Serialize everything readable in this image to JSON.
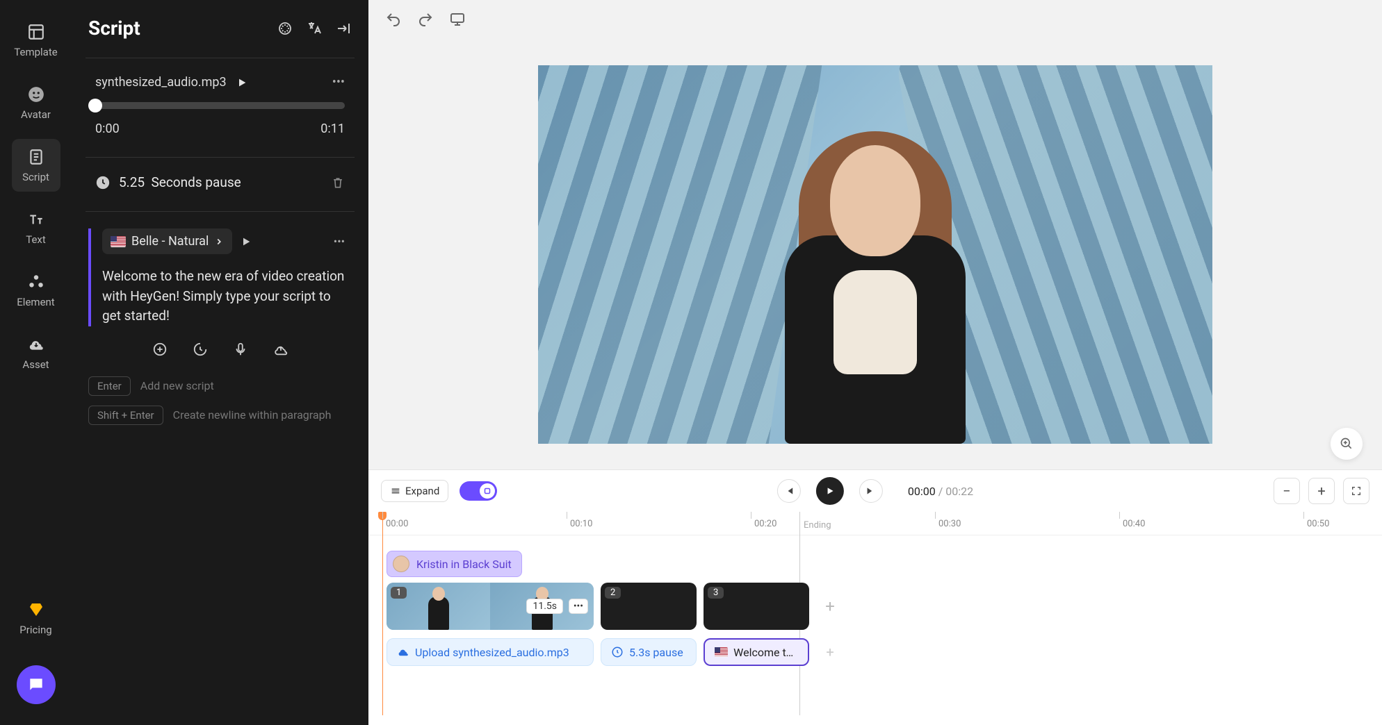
{
  "nav": {
    "template": "Template",
    "avatar": "Avatar",
    "script": "Script",
    "text": "Text",
    "element": "Element",
    "asset": "Asset",
    "pricing": "Pricing"
  },
  "panel": {
    "title": "Script",
    "audio": {
      "filename": "synthesized_audio.mp3",
      "current": "0:00",
      "total": "0:11"
    },
    "pause": {
      "value": "5.25",
      "label": "Seconds pause"
    },
    "voice": {
      "name": "Belle - Natural"
    },
    "script_text": "Welcome to the new era of video creation with HeyGen! Simply type your script to get started!",
    "hints": {
      "enter_key": "Enter",
      "enter_text": "Add new script",
      "shift_enter_key": "Shift + Enter",
      "shift_enter_text": "Create newline within paragraph"
    }
  },
  "timeline": {
    "expand": "Expand",
    "current": "00:00",
    "duration": "00:22",
    "ticks": [
      "00:00",
      "00:10",
      "00:20",
      "00:30",
      "00:40",
      "00:50"
    ],
    "ending_label": "Ending",
    "track_label": "Kristin in Black Suit",
    "clips": [
      {
        "num": "1",
        "duration": "11.5s"
      },
      {
        "num": "2"
      },
      {
        "num": "3"
      }
    ],
    "chips": {
      "upload": "Upload synthesized_audio.mp3",
      "pause": "5.3s pause",
      "welcome": "Welcome to..."
    }
  }
}
